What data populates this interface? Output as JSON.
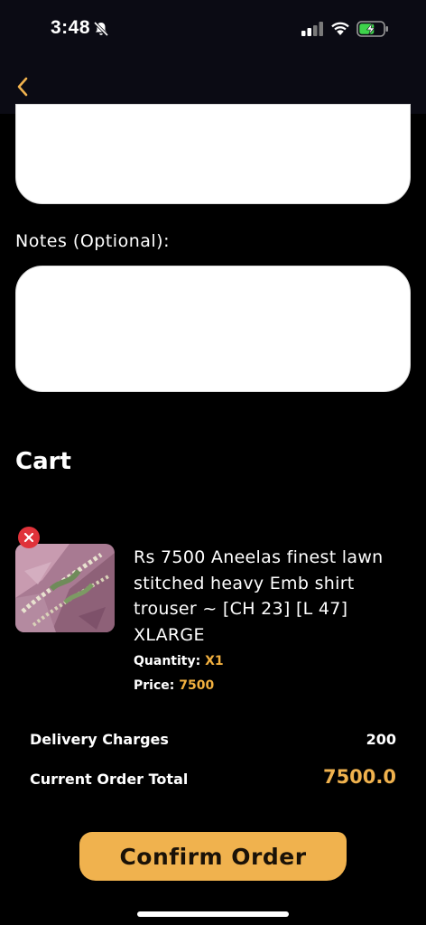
{
  "status_bar": {
    "time": "3:48",
    "icons": [
      "bell-slash-icon",
      "signal-icon",
      "wifi-icon",
      "battery-charging-icon"
    ]
  },
  "nav": {
    "back_icon": "chevron-left-icon"
  },
  "form": {
    "notes_label": "Notes (Optional):",
    "notes_value": ""
  },
  "cart": {
    "title": "Cart",
    "items": [
      {
        "name": "Rs 7500 Aneelas finest lawn stitched heavy Emb shirt trouser ~ [CH 23] [L 47] XLARGE",
        "quantity_label": "Quantity:",
        "quantity_value": "X1",
        "price_label": "Price:",
        "price_value": "7500"
      }
    ]
  },
  "summary": {
    "delivery_label": "Delivery Charges",
    "delivery_value": "200",
    "total_label": "Current Order Total",
    "total_value": "7500.0"
  },
  "actions": {
    "confirm_label": "Confirm Order"
  },
  "colors": {
    "accent": "#f0b24e",
    "background": "#000000",
    "remove": "#e0323a"
  }
}
